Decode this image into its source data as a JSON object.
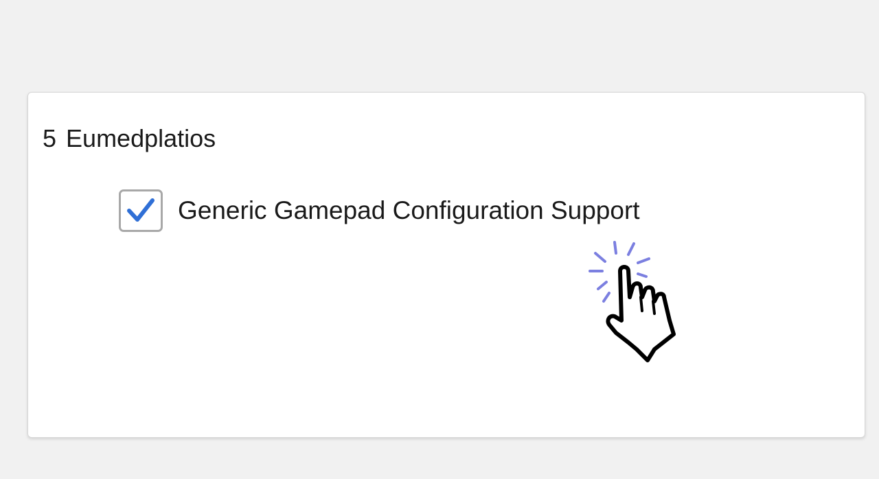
{
  "section": {
    "number": "5",
    "title": "Eumedplatios"
  },
  "option": {
    "label": "Generic Gamepad Configuration Support",
    "checked": true
  },
  "colors": {
    "page_background": "#f1f1f1",
    "card_background": "#ffffff",
    "checkmark": "#2f6fd6",
    "click_burst": "#7b7fe0"
  },
  "icons": {
    "checkmark": "checkmark-icon",
    "cursor": "hand-pointer-icon",
    "click_effect": "click-burst-icon"
  }
}
